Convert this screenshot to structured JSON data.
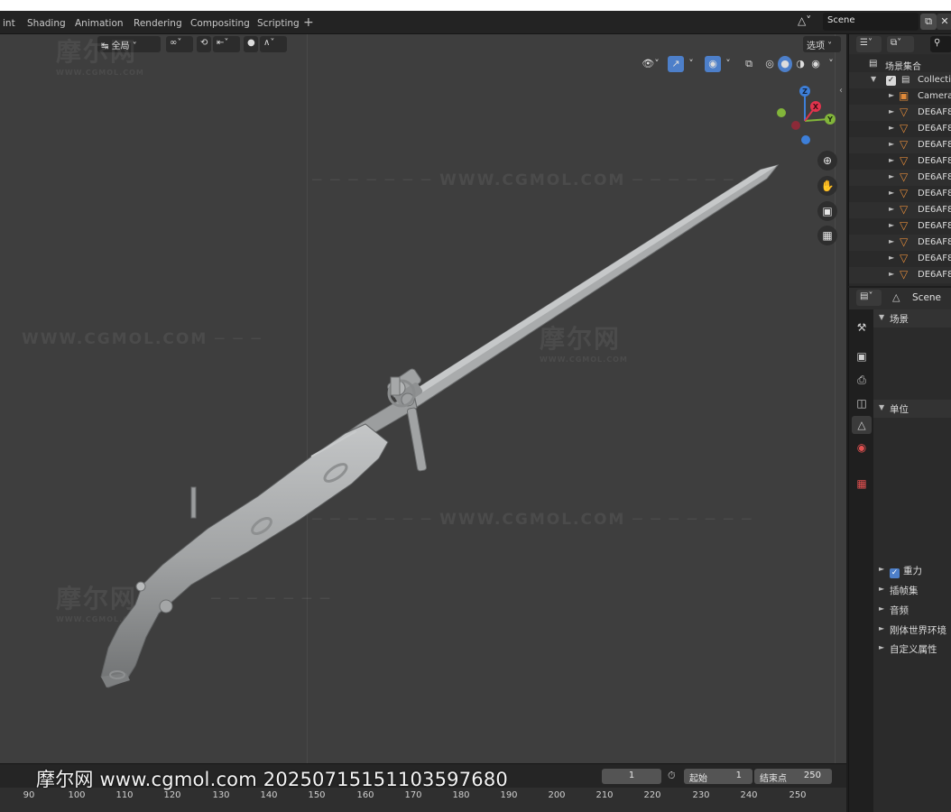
{
  "workspaces": [
    "int",
    "Shading",
    "Animation",
    "Rendering",
    "Compositing",
    "Scripting"
  ],
  "add_tab": "+",
  "scene": {
    "name": "Scene"
  },
  "viewport": {
    "transform_orientation": "全局",
    "options_label": "选项",
    "axes": {
      "z": "Z",
      "y": "Y",
      "x": "X"
    },
    "watermarks": {
      "logo": "摩尔网",
      "logo_sub": "WWW.CGMOL.COM",
      "site": "WWW.CGMOL.COM"
    }
  },
  "timeline": {
    "current_frame": "1",
    "start_label": "起始",
    "start_value": "1",
    "end_label": "结束点",
    "end_value": "250",
    "ruler": [
      "90",
      "100",
      "110",
      "120",
      "130",
      "140",
      "150",
      "160",
      "170",
      "180",
      "190",
      "200",
      "210",
      "220",
      "230",
      "240",
      "250"
    ]
  },
  "bottom_watermark": "摩尔网 www.cgmol.com 20250715151103597680",
  "outliner": {
    "root": "场景集合",
    "collection": "Collectio",
    "camera": "Camera",
    "objects": [
      "DE6AF8",
      "DE6AF8",
      "DE6AF8",
      "DE6AF8",
      "DE6AF8",
      "DE6AF8",
      "DE6AF8",
      "DE6AF8",
      "DE6AF8",
      "DE6AF8",
      "DE6AF8"
    ]
  },
  "properties": {
    "header": "Scene",
    "panels": {
      "scene": "场景",
      "units": "单位",
      "gravity": "重力",
      "keying_sets": "插帧集",
      "audio": "音频",
      "rigid_body_world": "刚体世界环境",
      "custom_props": "自定义属性"
    }
  },
  "colors": {
    "viewport_bg": "#3e3e3e",
    "model": "#9ea0a1",
    "axis_x": "#e0334c",
    "axis_y": "#82b53a",
    "axis_z": "#3d7fd9",
    "accent": "#4d7fc9"
  }
}
